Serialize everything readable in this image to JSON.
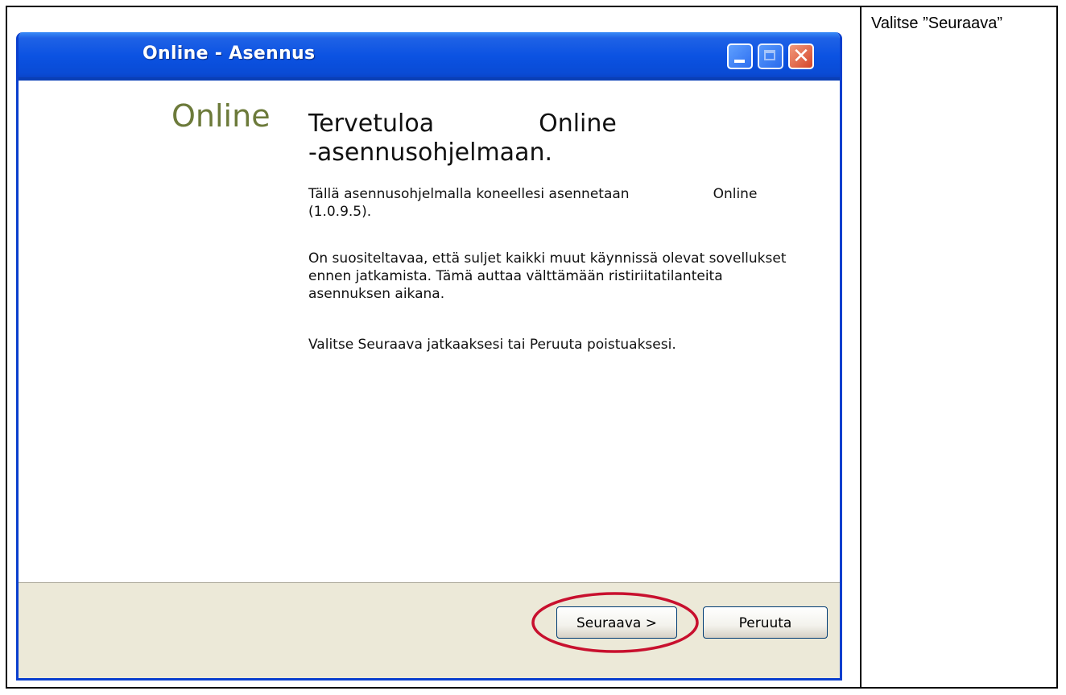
{
  "window": {
    "title": "Online - Asennus"
  },
  "installer": {
    "logo_text": "Online",
    "heading_line1_part1": "Tervetuloa",
    "heading_line1_part2": "Online",
    "heading_line2": "-asennusohjelmaan.",
    "paragraph1_part1": "Tällä asennusohjelmalla koneellesi asennetaan",
    "paragraph1_part2": "Online",
    "paragraph1_line2": "(1.0.9.5).",
    "paragraph2": "On suositeltavaa, että suljet kaikki muut käynnissä olevat sovellukset ennen jatkamista. Tämä auttaa välttämään ristiriitatilanteita asennuksen aikana.",
    "paragraph3": "Valitse Seuraava jatkaaksesi tai Peruuta poistuaksesi."
  },
  "buttons": {
    "next_label": "Seuraava >",
    "cancel_label": "Peruuta"
  },
  "side_note": {
    "text": "Valitse ”Seuraava”"
  },
  "colors": {
    "titlebar": "#0b52e2",
    "logo": "#6c7a3a",
    "highlight_ring": "#c8102e",
    "footer": "#ece9d8"
  },
  "icons": {
    "minimize": "minimize-icon",
    "maximize": "maximize-icon",
    "close": "close-icon"
  }
}
